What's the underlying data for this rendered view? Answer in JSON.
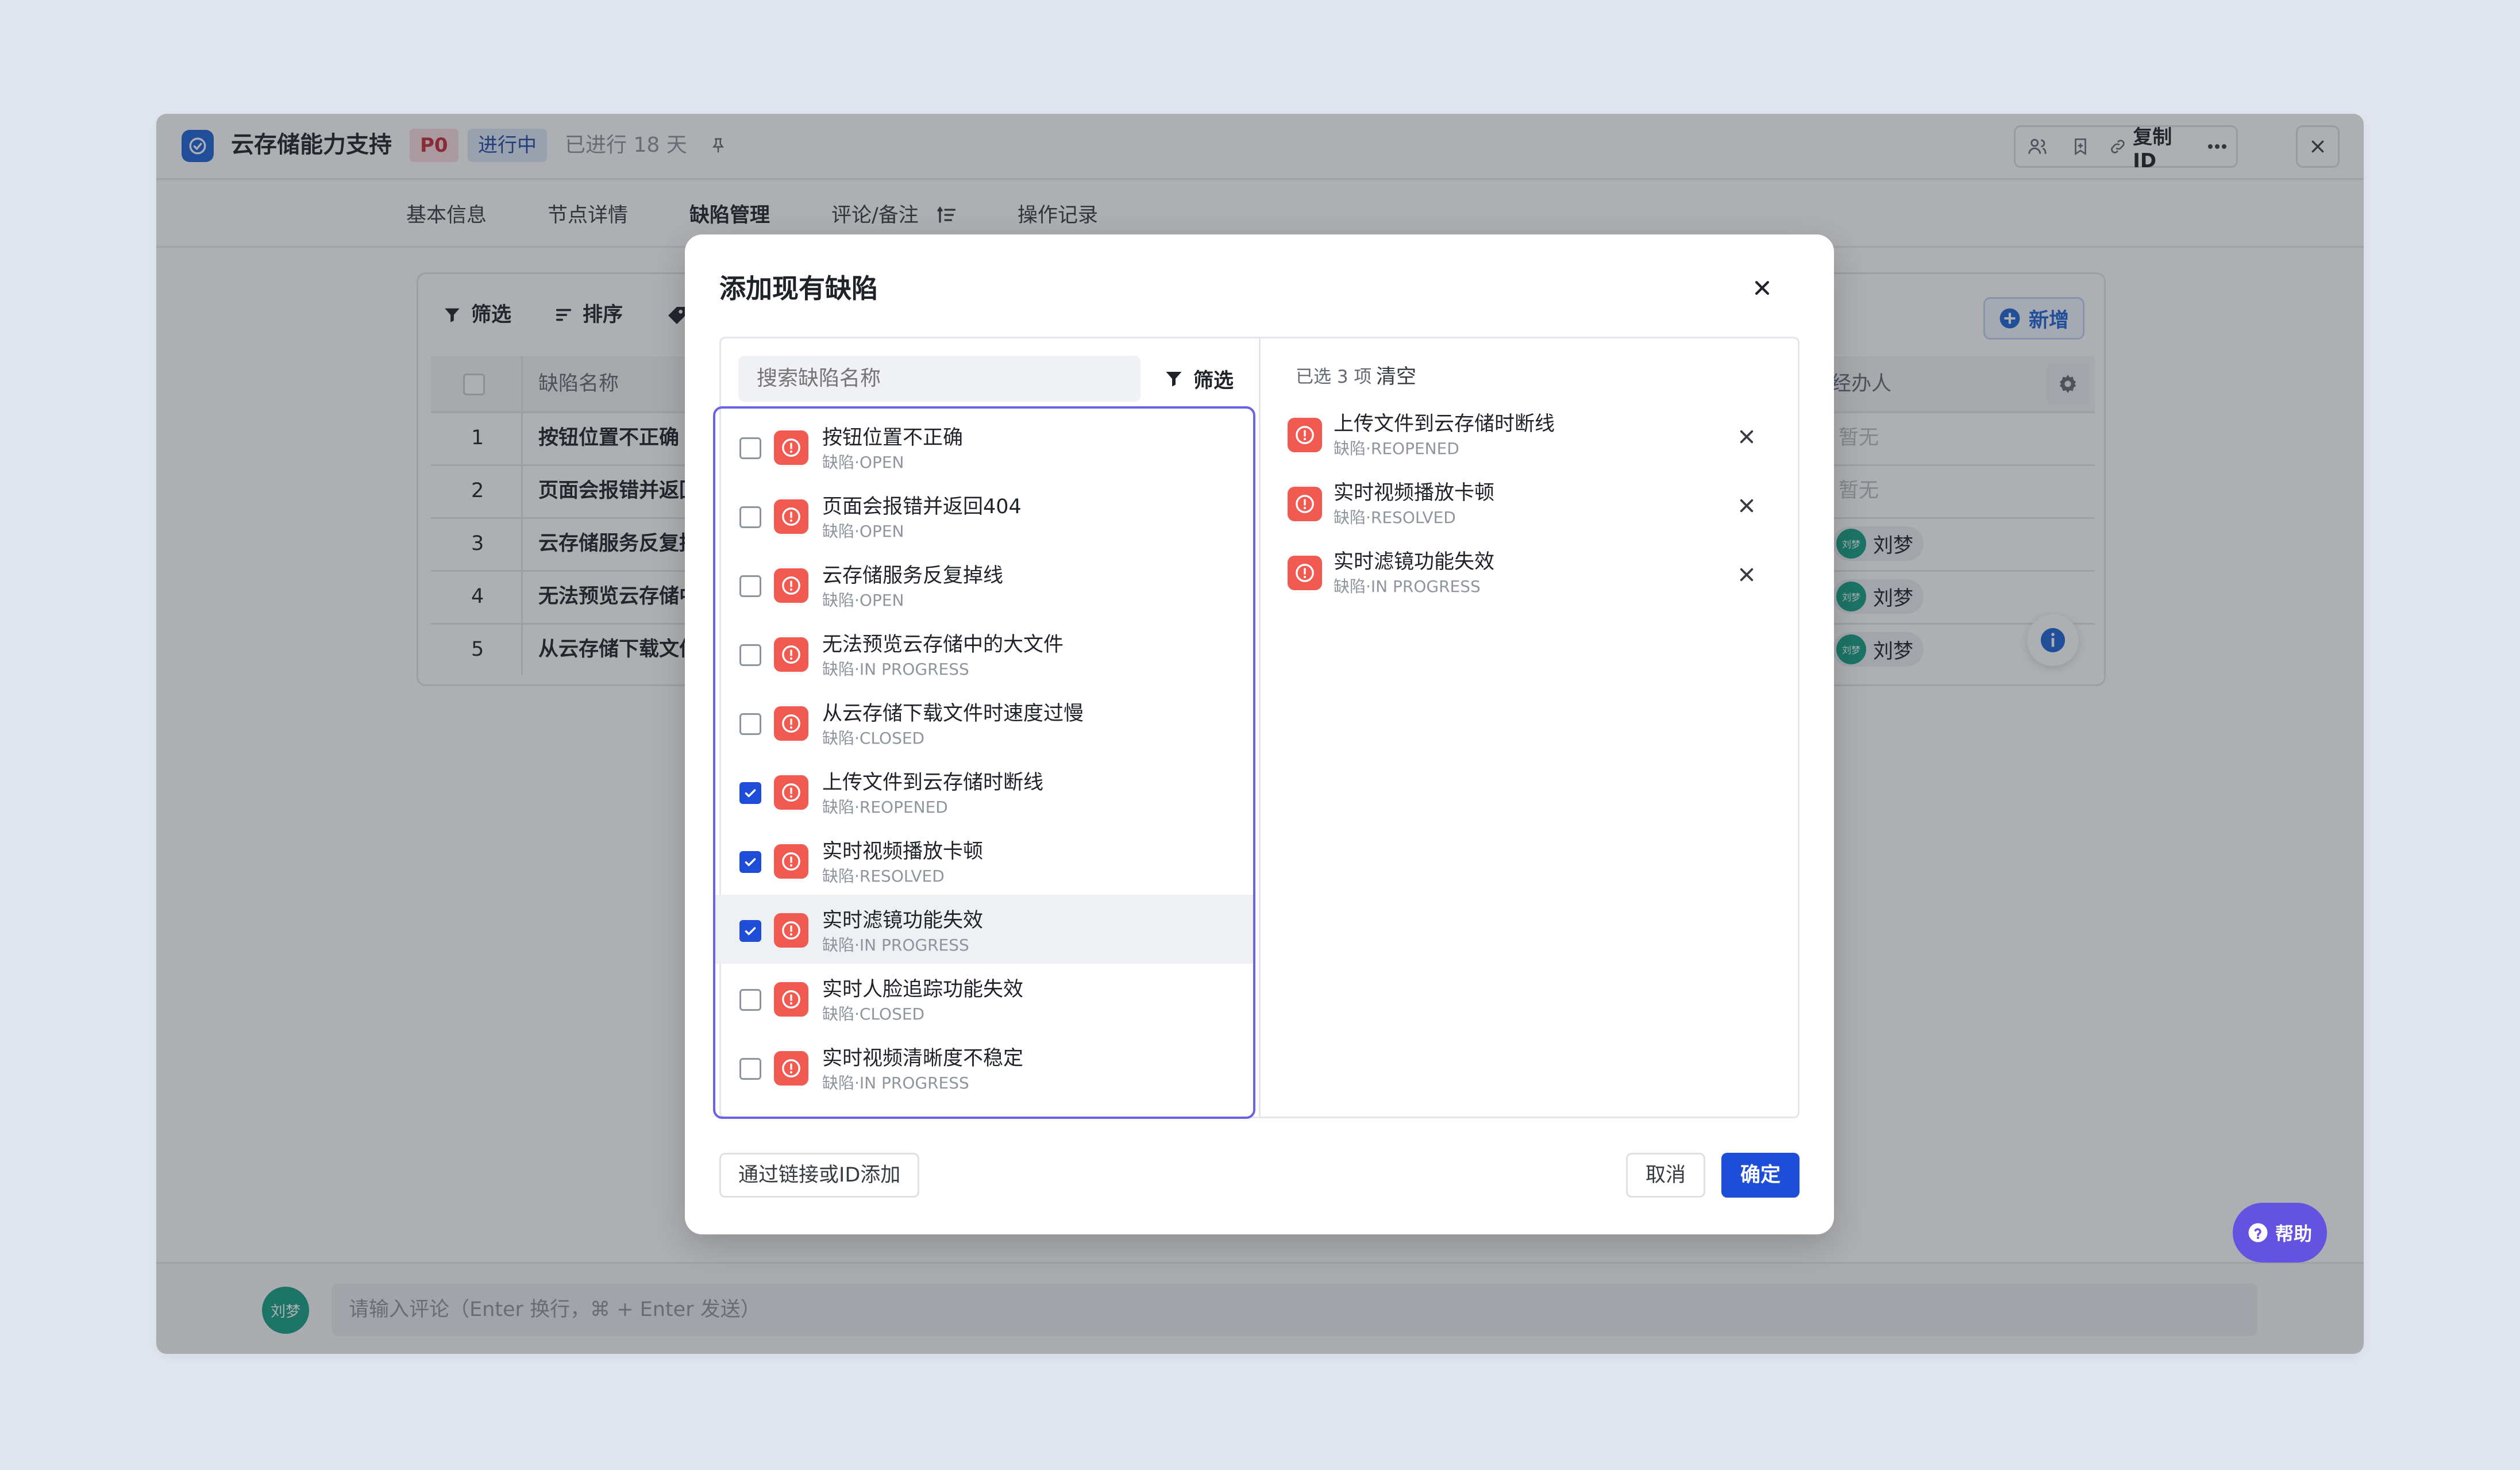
{
  "window": {
    "title": "云存储能力支持",
    "priority": "P0",
    "status": "进行中",
    "elapsed": "已进行 18 天",
    "copy_id_label": "复制ID"
  },
  "tabs": [
    {
      "label": "基本信息"
    },
    {
      "label": "节点详情"
    },
    {
      "label": "缺陷管理"
    },
    {
      "label": "评论/备注"
    },
    {
      "label": "操作记录"
    }
  ],
  "toolbar": {
    "filter_label": "筛选",
    "sort_label": "排序",
    "add_label": "新增"
  },
  "table": {
    "col_name": "缺陷名称",
    "col_assignee": "经办人",
    "rows": [
      {
        "index": "1",
        "name": "按钮位置不正确",
        "assignee": "暂无"
      },
      {
        "index": "2",
        "name": "页面会报错并返回",
        "assignee": "暂无"
      },
      {
        "index": "3",
        "name": "云存储服务反复掉",
        "assignee": "刘梦"
      },
      {
        "index": "4",
        "name": "无法预览云存储中",
        "assignee": "刘梦"
      },
      {
        "index": "5",
        "name": "从云存储下载文件",
        "assignee": "刘梦"
      }
    ],
    "avatar_text": "刘梦"
  },
  "comment": {
    "avatar": "刘梦",
    "placeholder": "请输入评论（Enter 换行，⌘ + Enter 发送）"
  },
  "help_label": "帮助",
  "modal": {
    "title": "添加现有缺陷",
    "search_placeholder": "搜索缺陷名称",
    "filter_label": "筛选",
    "selected_count": "已选 3 项",
    "clear_label": "清空",
    "items": [
      {
        "title": "按钮位置不正确",
        "sub": "缺陷·OPEN",
        "checked": false
      },
      {
        "title": "页面会报错并返回404",
        "sub": "缺陷·OPEN",
        "checked": false
      },
      {
        "title": "云存储服务反复掉线",
        "sub": "缺陷·OPEN",
        "checked": false
      },
      {
        "title": "无法预览云存储中的大文件",
        "sub": "缺陷·IN PROGRESS",
        "checked": false
      },
      {
        "title": "从云存储下载文件时速度过慢",
        "sub": "缺陷·CLOSED",
        "checked": false
      },
      {
        "title": "上传文件到云存储时断线",
        "sub": "缺陷·REOPENED",
        "checked": true
      },
      {
        "title": "实时视频播放卡顿",
        "sub": "缺陷·RESOLVED",
        "checked": true
      },
      {
        "title": "实时滤镜功能失效",
        "sub": "缺陷·IN PROGRESS",
        "checked": true
      },
      {
        "title": "实时人脸追踪功能失效",
        "sub": "缺陷·CLOSED",
        "checked": false
      },
      {
        "title": "实时视频清晰度不稳定",
        "sub": "缺陷·IN PROGRESS",
        "checked": false
      }
    ],
    "selected": [
      {
        "title": "上传文件到云存储时断线",
        "sub": "缺陷·REOPENED"
      },
      {
        "title": "实时视频播放卡顿",
        "sub": "缺陷·RESOLVED"
      },
      {
        "title": "实时滤镜功能失效",
        "sub": "缺陷·IN PROGRESS"
      }
    ],
    "link_add_label": "通过链接或ID添加",
    "cancel_label": "取消",
    "confirm_label": "确定"
  },
  "colors": {
    "accent": "#1e4ed8",
    "bug_icon": "#f15a50",
    "list_border": "#6b63e6",
    "help_button": "#6353e0"
  }
}
